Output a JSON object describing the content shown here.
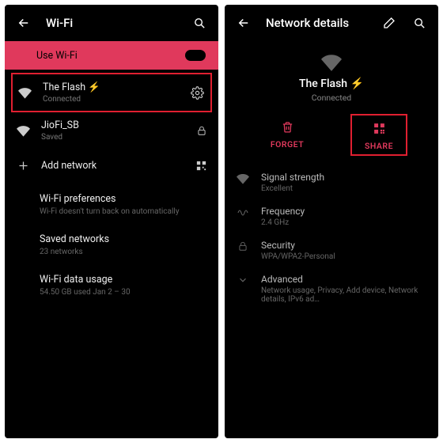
{
  "left": {
    "header_title": "Wi-Fi",
    "use_wifi_label": "Use Wi-Fi",
    "networks": [
      {
        "name": "The Flash ⚡",
        "status": "Connected",
        "highlighted": true,
        "trailing": "gear"
      },
      {
        "name": "JioFi_SB",
        "status": "Saved",
        "trailing": "lock"
      }
    ],
    "add_network_label": "Add network",
    "prefs": {
      "wifi_pref_label": "Wi-Fi preferences",
      "wifi_pref_sub": "Wi-Fi doesn't turn back on automatically",
      "saved_label": "Saved networks",
      "saved_sub": "23 networks",
      "usage_label": "Wi-Fi data usage",
      "usage_sub": "54.50 GB used Jan 2 – 30"
    }
  },
  "right": {
    "header_title": "Network details",
    "network_name": "The Flash ⚡",
    "network_status": "Connected",
    "actions": {
      "forget": "FORGET",
      "share": "SHARE"
    },
    "details": {
      "signal_label": "Signal strength",
      "signal_val": "Excellent",
      "freq_label": "Frequency",
      "freq_val": "2.4 GHz",
      "sec_label": "Security",
      "sec_val": "WPA/WPA2-Personal",
      "adv_label": "Advanced",
      "adv_val": "Network usage, Privacy, Add device, Network details, IPv6 ad…"
    }
  }
}
